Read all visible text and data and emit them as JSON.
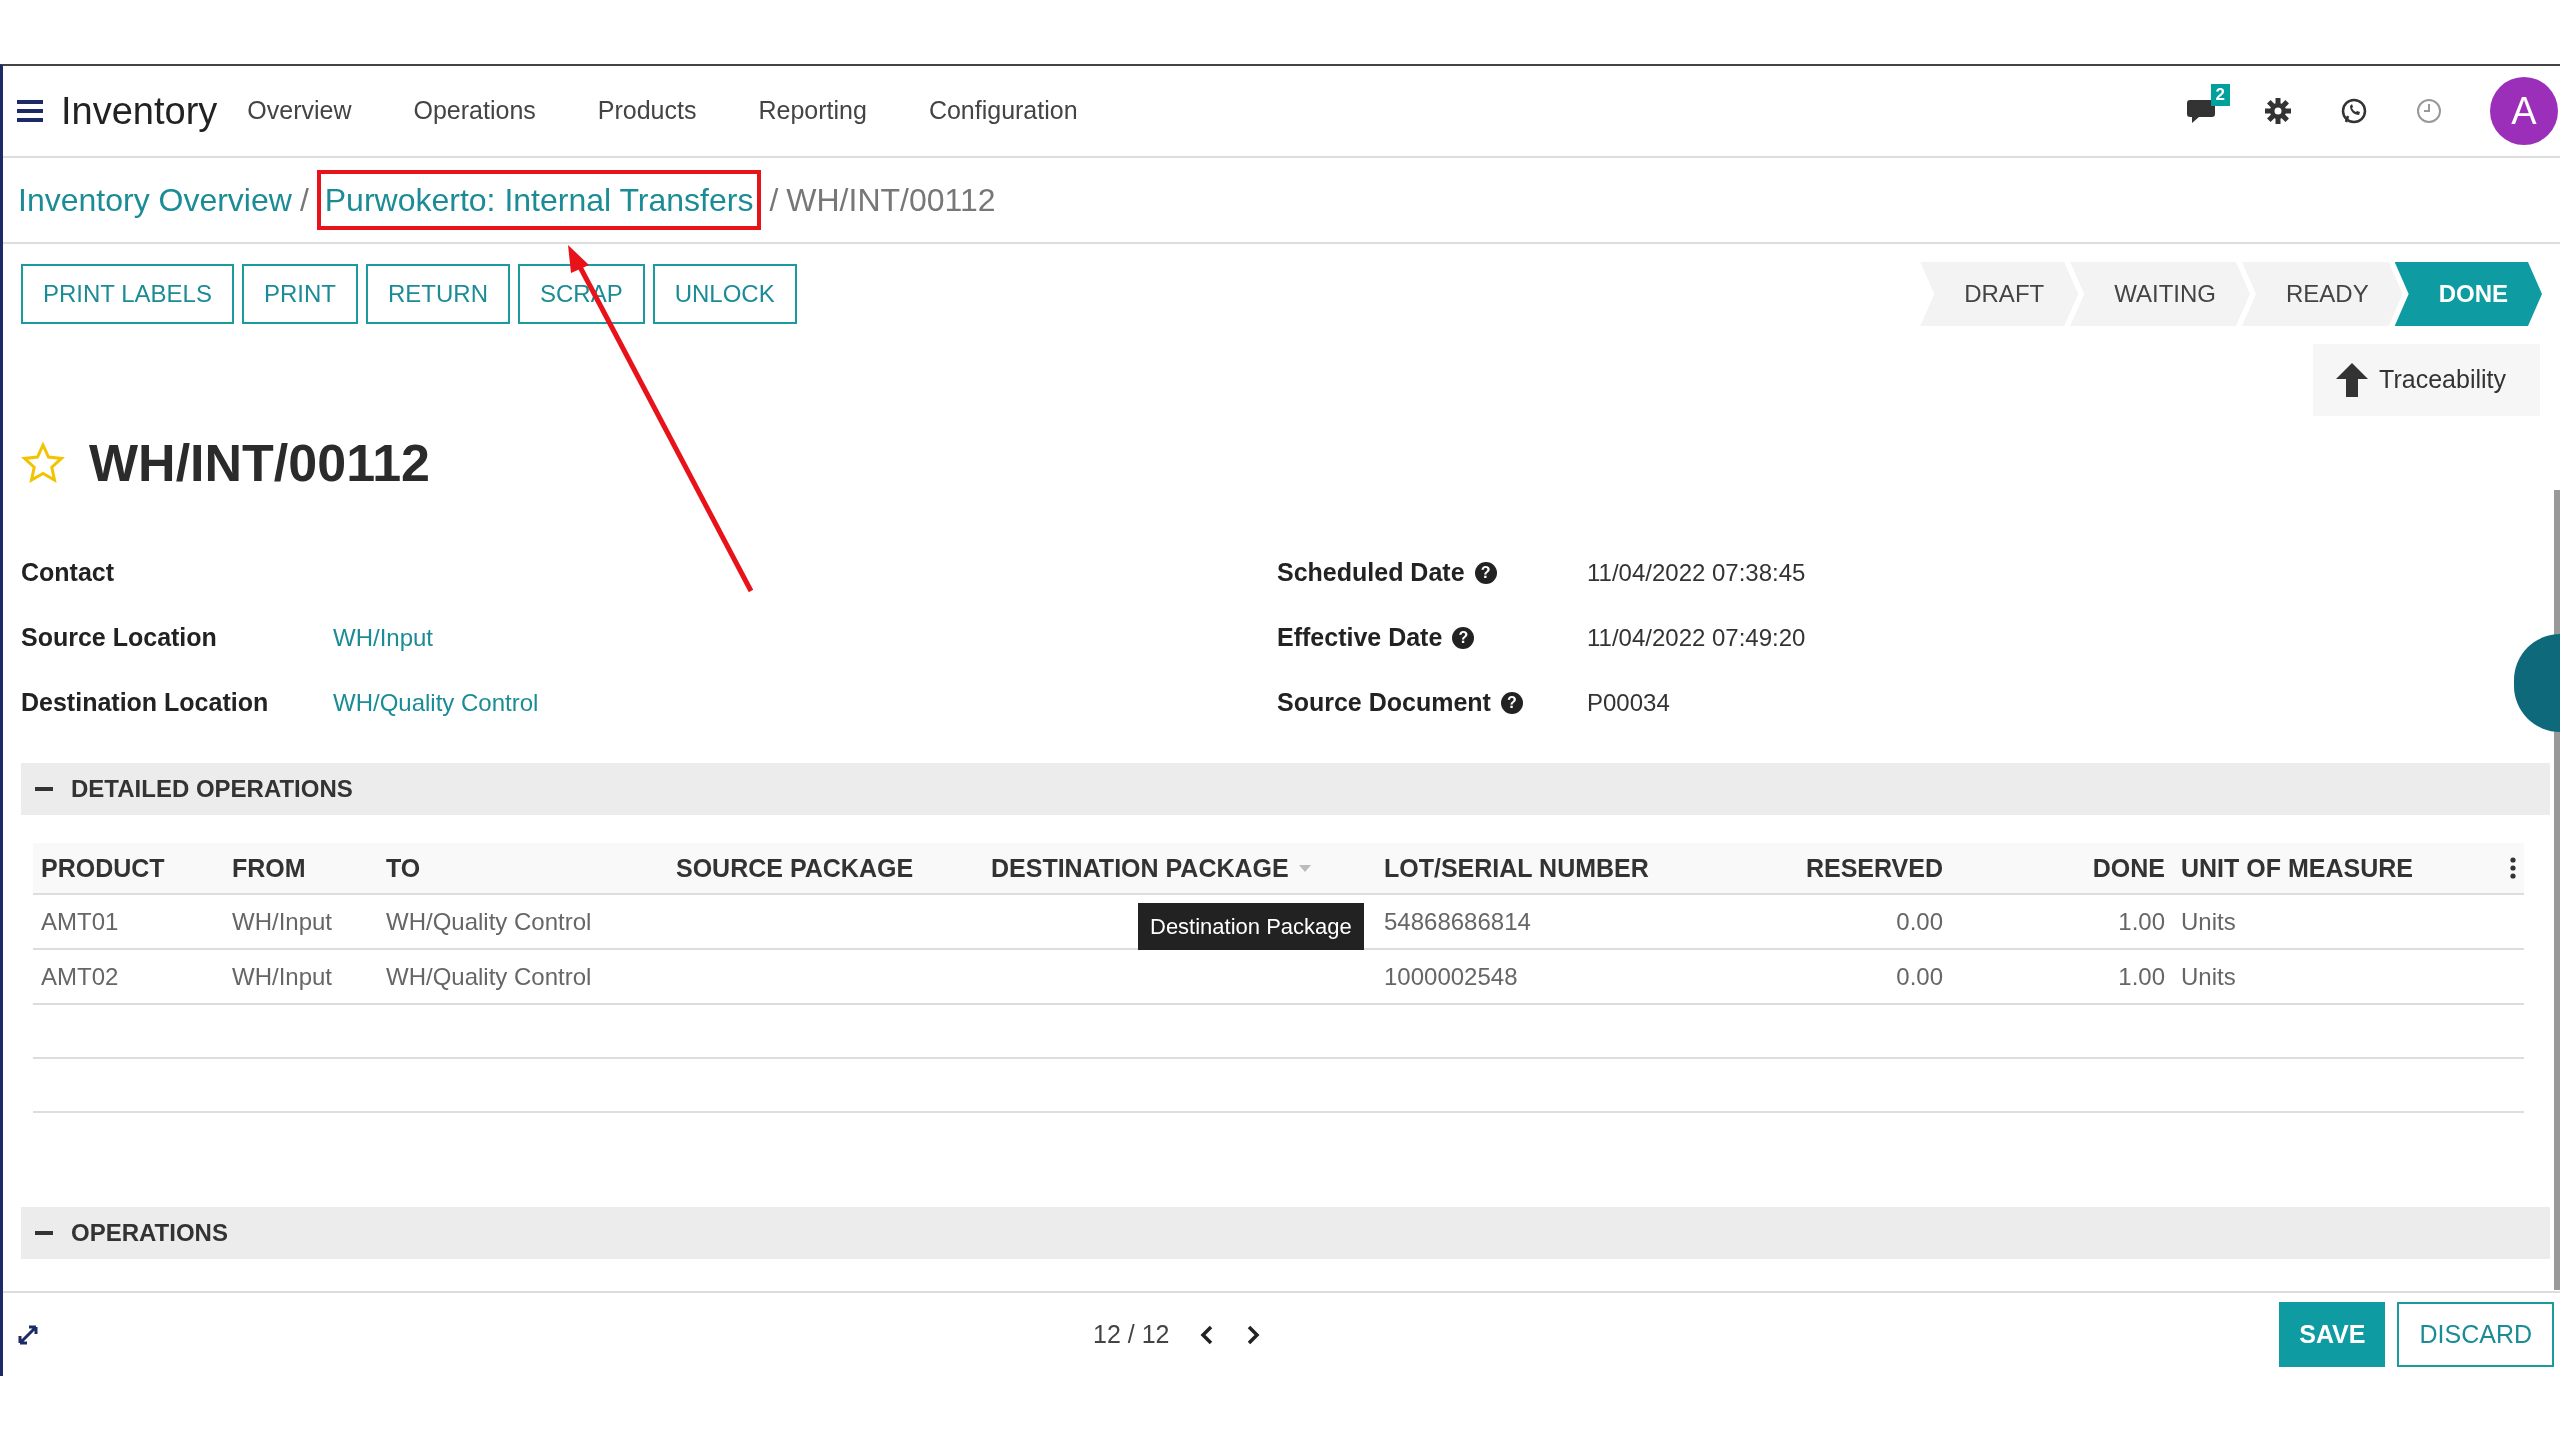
{
  "app": {
    "name": "Inventory",
    "menu": [
      "Overview",
      "Operations",
      "Products",
      "Reporting",
      "Configuration"
    ]
  },
  "systray": {
    "messages_count": "2",
    "avatar": "A"
  },
  "breadcrumb": [
    {
      "kind": "link",
      "label": "Inventory Overview",
      "highlighted": false
    },
    {
      "kind": "separator",
      "label": "/"
    },
    {
      "kind": "link",
      "label": "Purwokerto: Internal Transfers",
      "highlighted": true
    },
    {
      "kind": "separator",
      "label": "/"
    },
    {
      "kind": "current",
      "label": "WH/INT/00112",
      "highlighted": false
    }
  ],
  "actions": [
    "PRINT LABELS",
    "PRINT",
    "RETURN",
    "SCRAP",
    "UNLOCK"
  ],
  "stages": [
    {
      "label": "DRAFT",
      "selected": false
    },
    {
      "label": "WAITING",
      "selected": false
    },
    {
      "label": "READY",
      "selected": false
    },
    {
      "label": "DONE",
      "selected": true
    }
  ],
  "smart_button": "Traceability",
  "title": {
    "text": "WH/INT/00112",
    "starred": false
  },
  "fields_left": [
    {
      "label": "Contact"
    },
    {
      "label": "Source Location",
      "value": "WH/Input",
      "kind": "link"
    },
    {
      "label": "Destination Location",
      "value": "WH/Quality Control",
      "kind": "link"
    }
  ],
  "fields_right": [
    {
      "label": "Scheduled Date",
      "help": "?",
      "value": "11/04/2022 07:38:45",
      "kind": "text"
    },
    {
      "label": "Effective Date",
      "help": "?",
      "value": "11/04/2022 07:49:20",
      "kind": "text"
    },
    {
      "label": "Source Document",
      "help": "?",
      "value": "P00034",
      "kind": "text"
    }
  ],
  "detailed_operations": {
    "title": "DETAILED OPERATIONS",
    "expanded": true,
    "columns": [
      {
        "label": "PRODUCT",
        "kind": "text"
      },
      {
        "label": "FROM",
        "kind": "text"
      },
      {
        "label": "TO",
        "kind": "text"
      },
      {
        "label": "SOURCE PACKAGE",
        "kind": "text"
      },
      {
        "label": "DESTINATION PACKAGE",
        "kind": "text",
        "sortable": true
      },
      {
        "label": "LOT/SERIAL NUMBER",
        "kind": "text"
      },
      {
        "label": "RESERVED",
        "kind": "number"
      },
      {
        "label": "DONE",
        "kind": "number"
      },
      {
        "label": "UNIT OF MEASURE",
        "kind": "text"
      }
    ],
    "rows": [
      [
        "AMT01",
        "WH/Input",
        "WH/Quality Control",
        "",
        "",
        "54868686814",
        "0.00",
        "1.00",
        "Units"
      ],
      [
        "AMT02",
        "WH/Input",
        "WH/Quality Control",
        "",
        "",
        "1000002548",
        "0.00",
        "1.00",
        "Units"
      ]
    ],
    "tooltip": "Destination Package"
  },
  "operations": {
    "title": "OPERATIONS",
    "expanded": true
  },
  "pager": "12 / 12",
  "footer_buttons": [
    {
      "label": "SAVE",
      "kind": "primary"
    },
    {
      "label": "DISCARD",
      "kind": "secondary"
    }
  ]
}
